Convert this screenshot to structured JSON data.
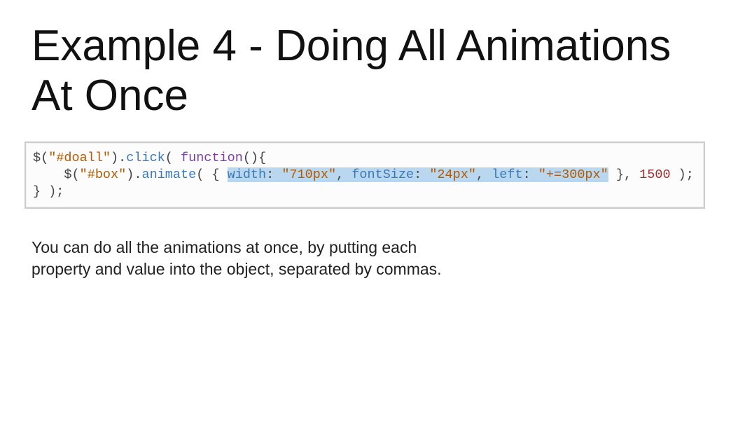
{
  "title": "Example 4 - Doing All Animations At Once",
  "code": {
    "l1_a": "$(",
    "l1_b": "\"#doall\"",
    "l1_c": ").",
    "l1_d": "click",
    "l1_e": "( ",
    "l1_f": "function",
    "l1_g": "(){",
    "l2_a": "    $(",
    "l2_b": "\"#box\"",
    "l2_c": ").",
    "l2_d": "animate",
    "l2_e": "( { ",
    "l2_hl_a": "width",
    "l2_hl_b": ": ",
    "l2_hl_c": "\"710px\"",
    "l2_hl_d": ", ",
    "l2_hl_e": "fontSize",
    "l2_hl_f": ": ",
    "l2_hl_g": "\"24px\"",
    "l2_hl_h": ", ",
    "l2_hl_i": "left",
    "l2_hl_j": ": ",
    "l2_hl_k": "\"+=300px\"",
    "l2_f": " }, ",
    "l2_g": "1500",
    "l2_h": " );",
    "l3_a": "} );"
  },
  "explain": "You can do all the animations at once, by putting each property and value into the object, separated by commas."
}
